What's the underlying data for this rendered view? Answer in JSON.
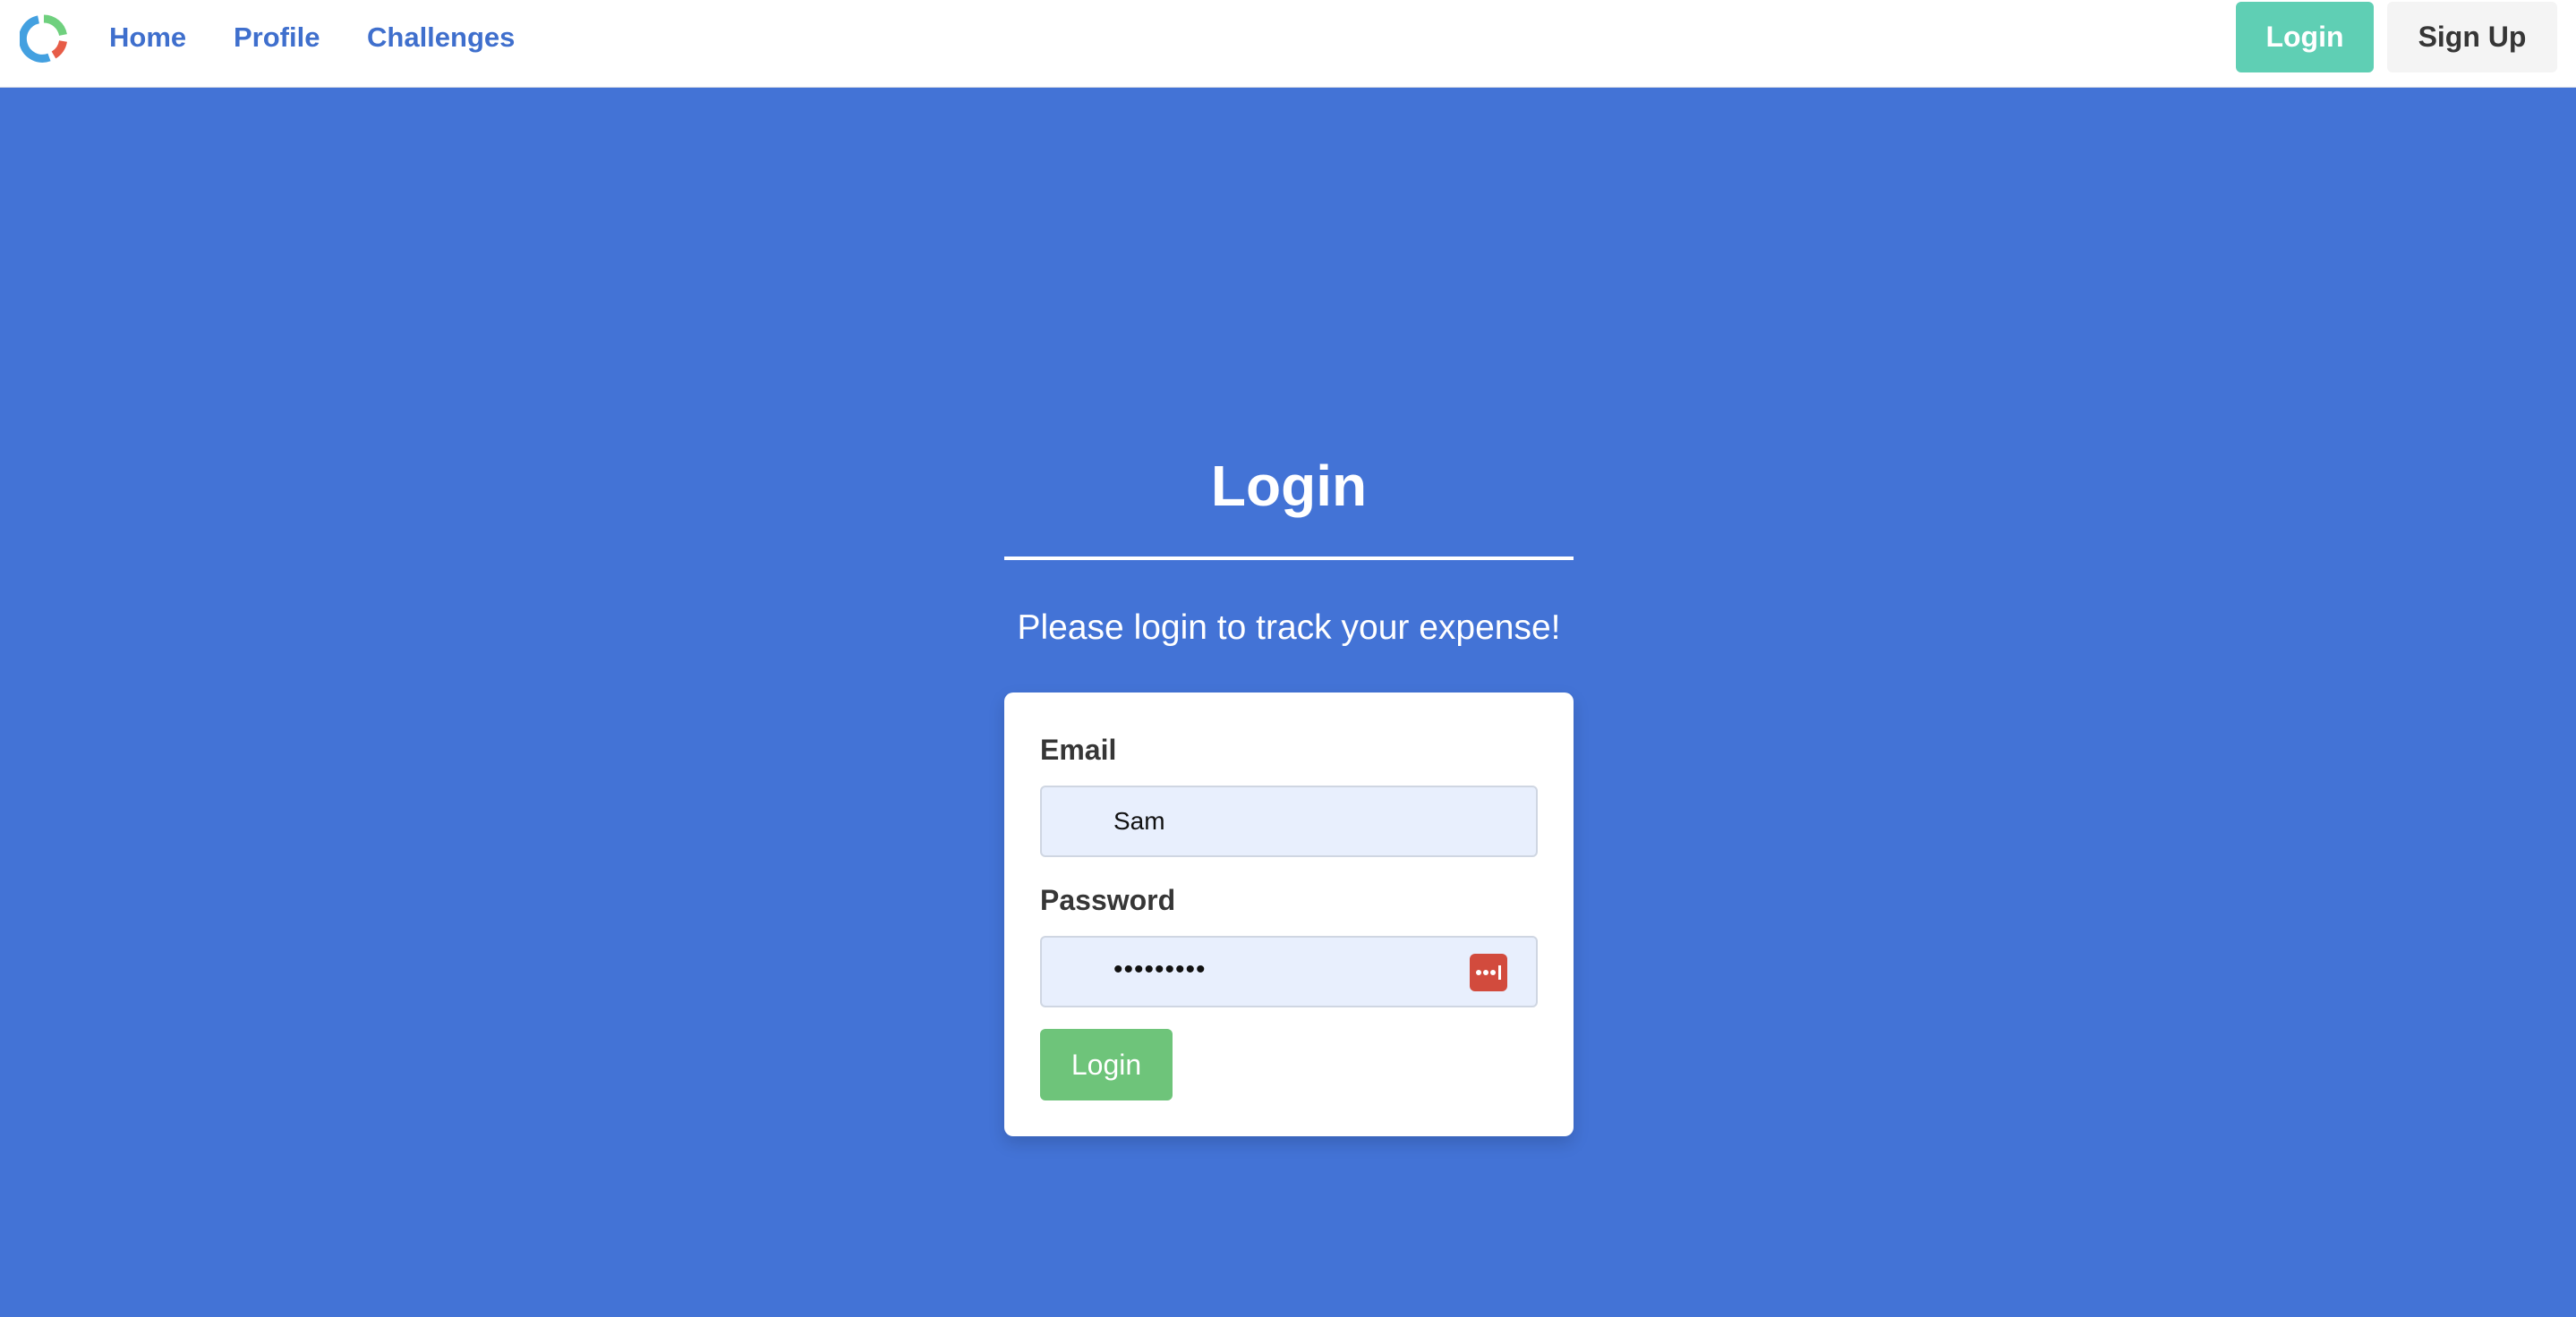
{
  "nav": {
    "links": [
      "Home",
      "Profile",
      "Challenges"
    ],
    "login_label": "Login",
    "signup_label": "Sign Up"
  },
  "main": {
    "title": "Login",
    "subtitle": "Please login to track your expense!"
  },
  "form": {
    "email_label": "Email",
    "email_value": "Sam",
    "password_label": "Password",
    "password_mask": "•••••••••",
    "submit_label": "Login",
    "password_manager_icon": "password-manager-icon"
  },
  "colors": {
    "background": "#4373d6",
    "nav_link": "#3f6fcd",
    "login_top": "#5fcfb4",
    "submit": "#6ec47a",
    "input_bg": "#e8effd"
  }
}
